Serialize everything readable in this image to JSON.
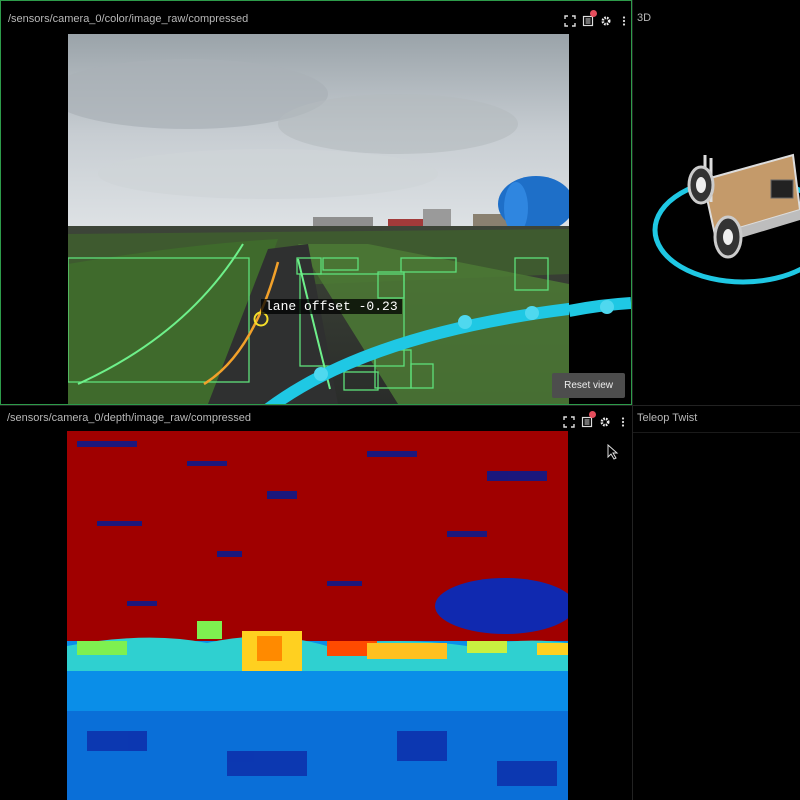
{
  "panels": {
    "color": {
      "title": "/sensors/camera_0/color/image_raw/compressed",
      "reset_label": "Reset view",
      "lane_label": "lane offset -0.23"
    },
    "three_d": {
      "title": "3D"
    },
    "depth": {
      "title": "/sensors/camera_0/depth/image_raw/compressed"
    },
    "twist": {
      "title": "Teleop Twist"
    }
  },
  "toolbar_icons": [
    "fullscreen-icon",
    "topics-list-icon",
    "settings-gear-icon",
    "more-menu-icon"
  ],
  "colors": {
    "accent_green": "#2d9b4a",
    "notify_red": "#e54d5c",
    "path_cyan": "#1fc8e4",
    "lane_orange": "#f0a020",
    "lane_green": "#4fe070"
  }
}
